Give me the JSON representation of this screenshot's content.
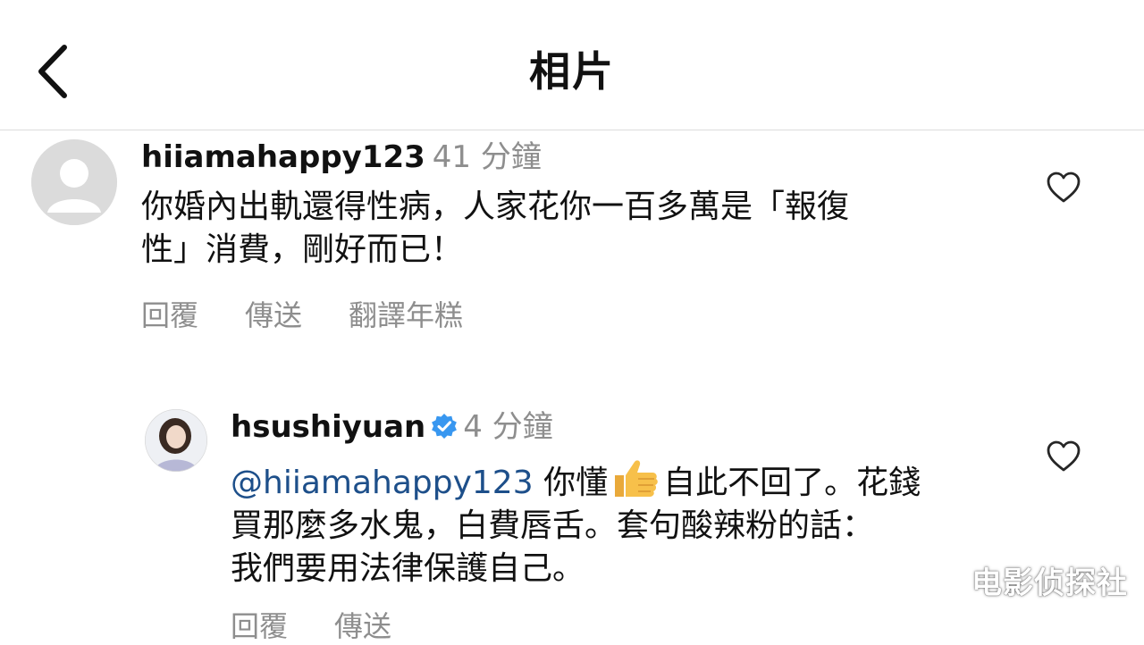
{
  "header": {
    "title": "相片",
    "back_icon": "chevron-left-icon"
  },
  "comments": [
    {
      "username": "hiiamahappy123",
      "time": "41 分鐘",
      "text_lines": [
        "你婚內出軌還得性病，人家花你一百多萬是「報復",
        "性」消費，剛好而已！"
      ],
      "actions": [
        "回覆",
        "傳送",
        "翻譯年糕"
      ],
      "avatar_icon": "default-avatar-icon",
      "like_icon": "heart-outline-icon"
    },
    {
      "username": "hsushiyuan",
      "verified": true,
      "time": "4 分鐘",
      "mention": "@hiiamahappy123",
      "text_line1_after_mention": "你懂",
      "text_line1_after_emoji": "自此不回了。花錢",
      "text_lines_rest": [
        "買那麼多水鬼，白費唇舌。套句酸辣粉的話：",
        "我們要用法律保護自己。"
      ],
      "actions": [
        "回覆",
        "傳送"
      ],
      "emoji_icon": "thumbs-up-icon",
      "like_icon": "heart-outline-icon"
    }
  ],
  "watermark": "电影侦探社",
  "colors": {
    "mention": "#1d4f8a",
    "meta_gray": "#8e8e8e",
    "verified_blue": "#3897f0",
    "divider": "#dcdcdc"
  }
}
